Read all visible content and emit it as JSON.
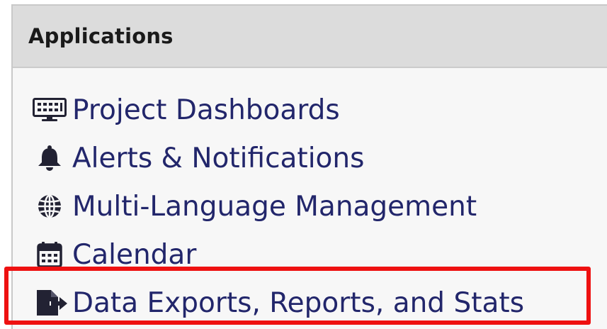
{
  "panel": {
    "title": "Applications"
  },
  "menu": {
    "items": [
      {
        "label": "Project Dashboards",
        "icon": "dashboard-monitor-icon"
      },
      {
        "label": "Alerts & Notifications",
        "icon": "bell-icon"
      },
      {
        "label": "Multi-Language Management",
        "icon": "globe-icon"
      },
      {
        "label": "Calendar",
        "icon": "calendar-icon"
      },
      {
        "label": "Data Exports, Reports, and Stats",
        "icon": "file-export-icon"
      }
    ]
  },
  "colors": {
    "link_text": "#22266b",
    "icon": "#222233",
    "header_bg": "#dcdcdc",
    "panel_bg": "#f7f7f7",
    "highlight": "#ee1111"
  }
}
